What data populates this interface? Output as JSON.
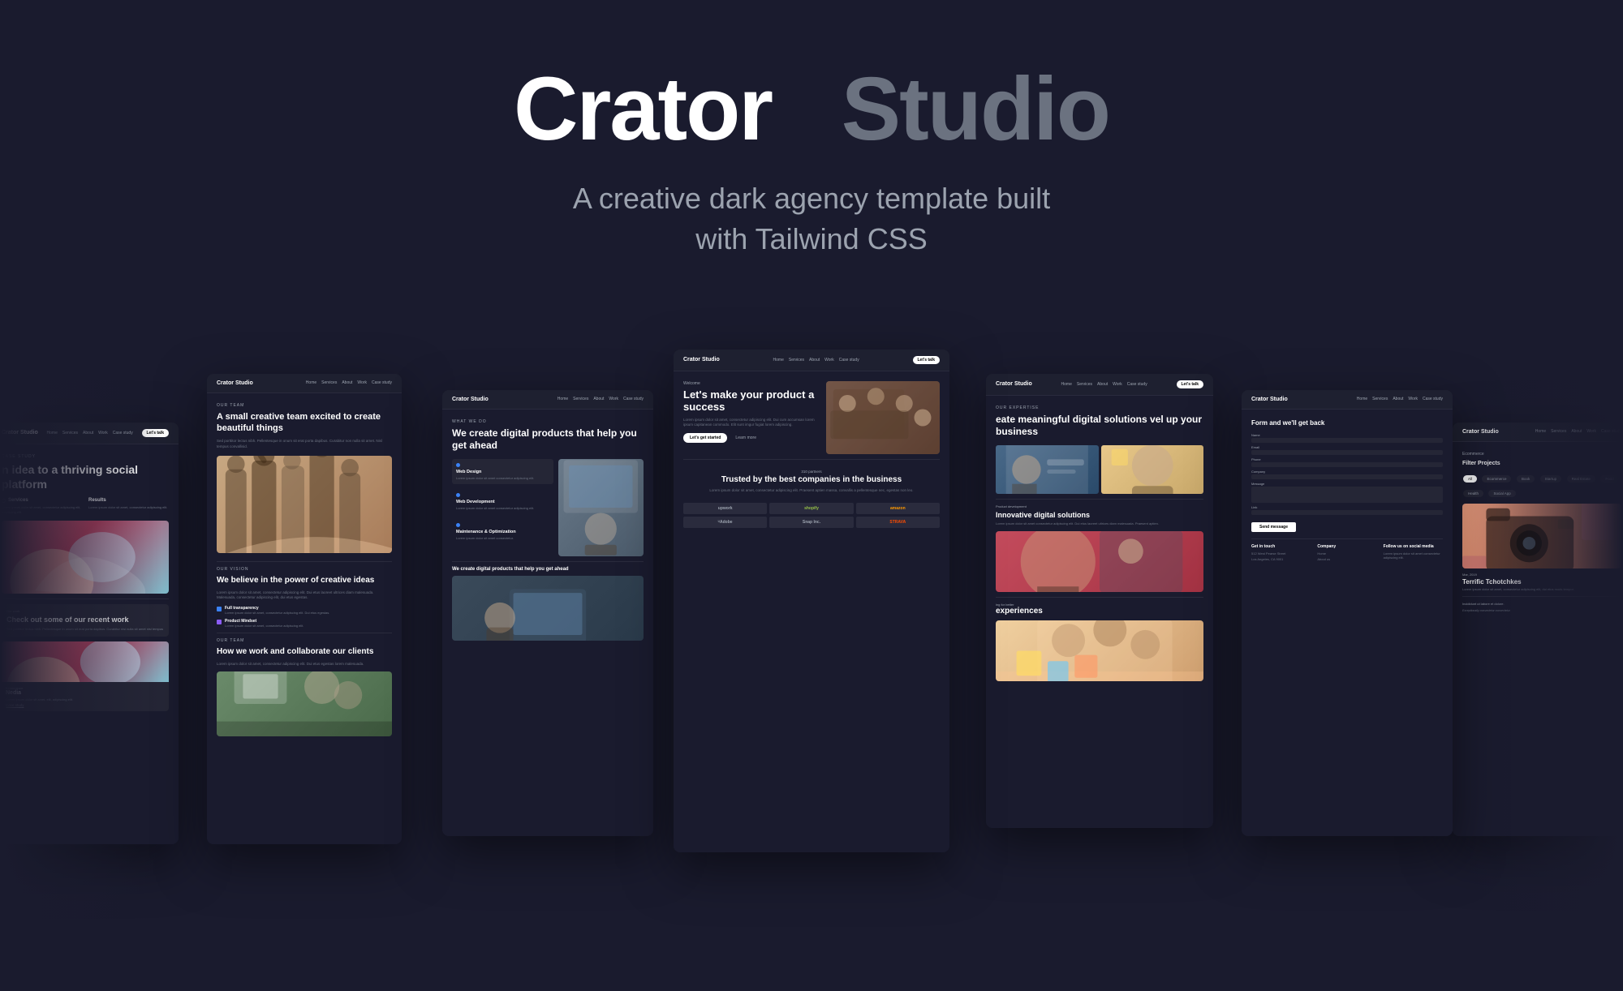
{
  "hero": {
    "title_white": "Crator",
    "title_gray": "Studio",
    "subtitle_line1": "A creative dark agency template built",
    "subtitle_line2": "with Tailwind CSS"
  },
  "cards": {
    "center": {
      "nav_logo": "Crator Studio",
      "nav_links": [
        "Home",
        "Services",
        "About",
        "Work",
        "Case study"
      ],
      "nav_btn": "Let's talk",
      "section_label": "Welcome",
      "heading": "Let's make your product a success",
      "body_text": "Lorem ipsum dolor sit amet, consectetur adipiscing elit. Dui cum accumsan lorem ipsum capitanean commodo. Elit sunt imgur fugiat lorem adipiscing.",
      "cta1": "Let's get started",
      "cta2": "Learn more",
      "trusted_label": "310 partners",
      "trusted_heading": "Trusted by the best companies in the business",
      "trusted_body": "Lorem ipsum dolor sit amet, consectetur adipiscing elit. Praesent aptien massa, convallis a pellentesque nec, egestas non leo.",
      "logos": [
        "upwork",
        "shopify",
        "amazon",
        "Adobe",
        "Snap Inc.",
        "STRAVA"
      ]
    },
    "mid_left": {
      "nav_logo": "Crator Studio",
      "nav_links": [
        "Home",
        "Services",
        "About",
        "Work",
        "Case study"
      ],
      "section_label": "Our team",
      "heading": "A small creative team excited to create beautiful things",
      "body_text": "Sed porttitor lectus nibh. Pellentesque in onum sit erat porta dapibus. Curabitur non nulla sit amet. Nisl tempus convallisid.",
      "section2_label": "Our vision",
      "heading2": "We believe in the power of creative ideas",
      "body2": "Lorem ipsum dolor sit amet, consectetur adipiscing elit. Dui etus laoreet ultrices diam malesuada. Malesuada, consectetur adipiscing elit, dui etus egestas.",
      "feature1_title": "Full transparency",
      "feature1_desc": "Lorem ipsum dolor sit amet, consectetur adipiscing elit. Dui etus egestas.",
      "feature2_title": "Product Mindset",
      "feature2_desc": "Lorem ipsum dolor sit amet, consectetur adipiscing elit.",
      "section3_label": "Our team",
      "heading3": "How we work and collaborate our clients",
      "body3": "Lorem ipsum dolor sit amet, consectetur adipiscing elit. Dui etus egestas lorem malesuada."
    },
    "inner_left": {
      "nav_logo": "Crator Studio",
      "nav_links": [
        "Home",
        "Services",
        "About",
        "Work",
        "Case study"
      ],
      "section_label": "What we do",
      "heading": "We create digital products that help you get ahead",
      "services": [
        {
          "name": "Web Design",
          "desc": "Lorem ipsum dolor sit amet consectetur adipiscing elit."
        },
        {
          "name": "Web Development",
          "desc": "Lorem ipsum dolor sit amet consectetur adipiscing elit."
        },
        {
          "name": "Maintenance & Optimization",
          "desc": "Lorem ipsum dolor sit amet consectetur"
        }
      ]
    },
    "far_left": {
      "nav_logo": "Crator Studio",
      "nav_links": [
        "Home",
        "Services",
        "About",
        "Work",
        "Case study"
      ],
      "nav_btn": "Let's talk",
      "case_label": "Case study",
      "heading": "n idea to a thriving social platform",
      "services_title": "Services",
      "results_title": "Results",
      "services_text": "Lorem ipsum dolor sit amet, consectetur adipiscing elit, adipiscing elit.",
      "results_text": "Lorem ipsum dolor sit amet, consectetur adipiscing elit.",
      "work_label": "Our work",
      "work_heading": "Check out some of our recent work",
      "work_body": "Sed porttitor lectus nibh. Pellentesque in onum sit erat porta dapibus. Curabitur nisi nulla sit amet nisl tempus",
      "item_label": "Ecommerce",
      "item_title": "Nedia",
      "item_desc": "Lorem ipsum dolor sit amet, elit, adipiscing elit.",
      "case_study_link": "Case study"
    },
    "inner_right": {
      "nav_logo": "Crator Studio",
      "nav_links": [
        "Home",
        "Services",
        "About",
        "Work",
        "Case study"
      ],
      "nav_btn": "Let's talk",
      "section_label": "Our expertise",
      "heading": "eate meaningful digital solutions vel up your business",
      "section2_label": "Product development",
      "heading2": "Innovative digital solutions",
      "body2": "Lorem ipsum dolor sit amet consectetur adipiscing elit. Dui etus laoreet ultrices diam malesuada. Praesent aptien.",
      "section3_label": "ing for better",
      "heading3": "experiences"
    },
    "mid_right": {
      "nav_logo": "Crator Studio",
      "nav_links": [
        "Home",
        "Services",
        "About",
        "Work",
        "Case study"
      ],
      "heading": "Form and we'll get back",
      "form_fields": [
        "Name",
        "Email",
        "Phone",
        "Company",
        "Message",
        "Link"
      ],
      "submit_label": "Send message",
      "footer_col1_title": "Get in touch",
      "footer_col1_items": [
        "512 West Pearse Street",
        "Los Angeles, CA 9001"
      ],
      "footer_col2_title": "Company",
      "footer_col2_items": [
        "Home",
        "About us"
      ],
      "footer_col3_title": "Follow us on social media",
      "footer_col3_items": [
        "Lorem ipsum dolor sit amet consectetur adipiscing elit."
      ]
    },
    "far_right": {
      "nav_logo": "Crator Studio",
      "nav_links": [
        "Home",
        "Services",
        "About",
        "Work",
        "Case study"
      ],
      "section_label": "Ecommerce",
      "filter_title": "Filter Projects",
      "filters": [
        "All",
        "Ecommerce",
        "Book",
        "Startup",
        "Real Estate",
        "Food",
        "Health",
        "Social App"
      ],
      "project_date": "Mar, 2019",
      "project_title": "Terrific Tchotchkes",
      "project_desc": "Lorem ipsum dolor sit amet, consectetur adipiscing elit, dui etus mods tempor.",
      "bottom_text": "Incididunt ut labore et dolore."
    }
  }
}
